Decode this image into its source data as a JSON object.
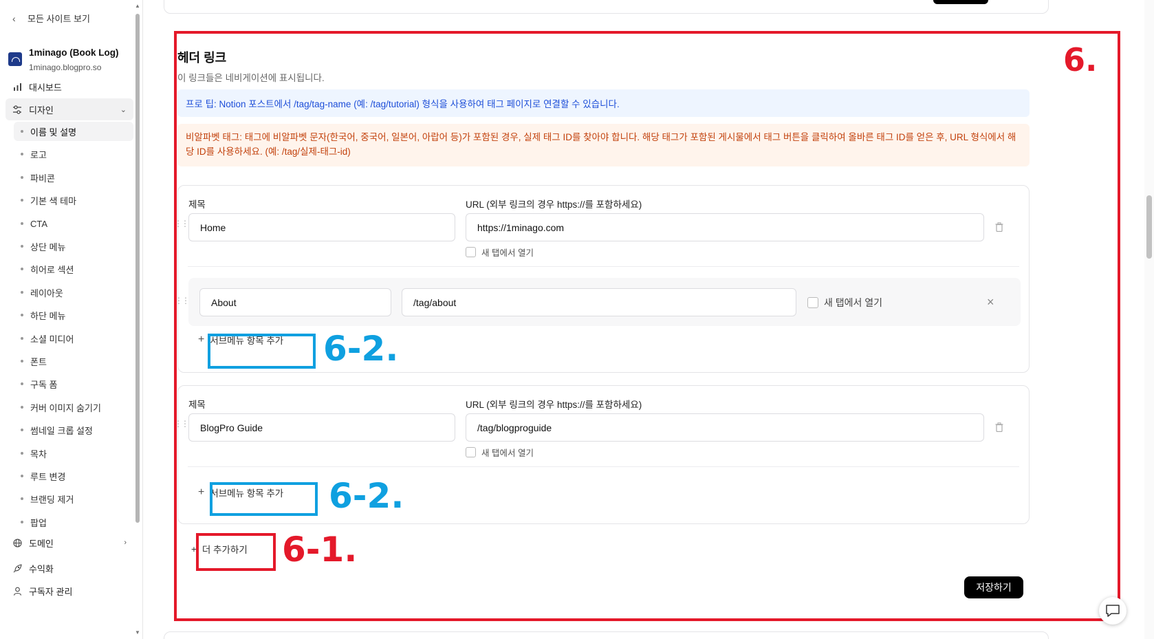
{
  "sidebar": {
    "back_label": "모든 사이트 보기",
    "site": {
      "name": "1minago (Book Log)",
      "url": "1minago.blogpro.so"
    },
    "top_items": [
      {
        "label": "대시보드",
        "icon": "bar-chart-icon"
      },
      {
        "label": "디자인",
        "icon": "sliders-icon",
        "expanded": true
      }
    ],
    "sub_items": [
      "이름 및 설명",
      "로고",
      "파비콘",
      "기본 색 테마",
      "CTA",
      "상단 메뉴",
      "히어로 섹션",
      "레이아웃",
      "하단 메뉴",
      "소셜 미디어",
      "폰트",
      "구독 폼",
      "커버 이미지 숨기기",
      "썸네일 크롭 설정",
      "목차",
      "루트 변경",
      "브랜딩 제거",
      "팝업"
    ],
    "active_sub": "이름 및 설명",
    "bottom_items": [
      {
        "label": "도메인",
        "icon": "globe-icon"
      },
      {
        "label": "수익화",
        "icon": "rocket-icon"
      },
      {
        "label": "구독자 관리",
        "icon": "user-icon"
      }
    ]
  },
  "section": {
    "title": "헤더 링크",
    "description": "이 링크들은 네비게이션에 표시됩니다.",
    "tip": "프로 팁: Notion 포스트에서 /tag/tag-name (예: /tag/tutorial) 형식을 사용하여 태그 페이지로 연결할 수 있습니다.",
    "warning": "비알파벳 태그: 태그에 비알파벳 문자(한국어, 중국어, 일본어, 아랍어 등)가 포함된 경우, 실제 태그 ID를 찾아야 합니다. 해당 태그가 포함된 게시물에서 태그 버튼을 클릭하여 올바른 태그 ID를 얻은 후, URL 형식에서 해당 ID를 사용하세요. (예: /tag/실제-태그-id)",
    "title_label": "제목",
    "url_label": "URL (외부 링크의 경우 https://를 포함하세요)",
    "new_tab_label": "새 탭에서 열기",
    "add_submenu_label": "서브메뉴 항목 추가",
    "add_more_label": "더 추가하기",
    "save_label": "저장하기",
    "links": [
      {
        "title": "Home",
        "url": "https://1minago.com",
        "submenu": [
          {
            "title": "About",
            "url": "/tag/about"
          }
        ]
      },
      {
        "title": "BlogPro Guide",
        "url": "/tag/blogproguide",
        "submenu": []
      }
    ]
  },
  "annotations": {
    "section": "6.",
    "add_more": "6-1.",
    "add_submenu_1": "6-2.",
    "add_submenu_2": "6-2.",
    "red_color": "#e4192a",
    "blue_color": "#0fa0e0"
  }
}
